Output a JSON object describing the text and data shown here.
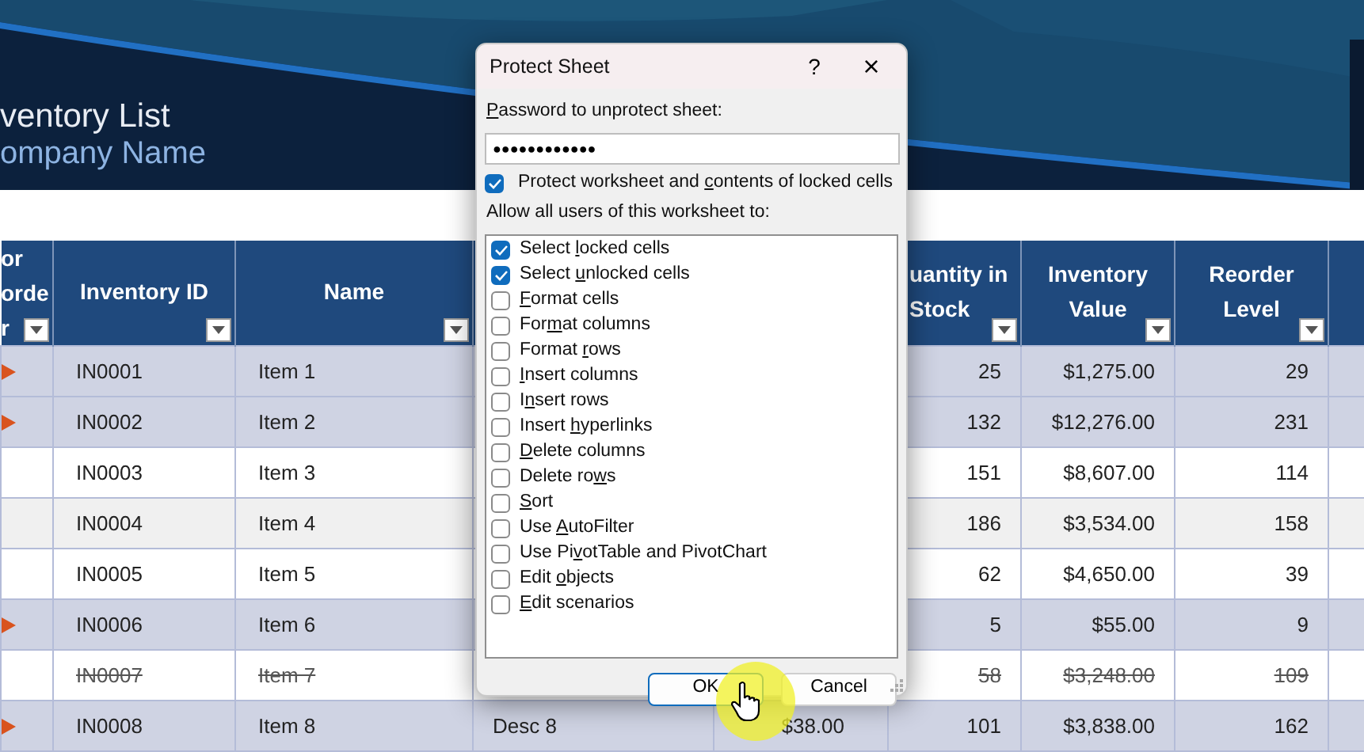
{
  "banner": {
    "title": "ventory List",
    "subtitle": "ompany Name"
  },
  "table": {
    "columns": [
      {
        "label_lines": [
          "or",
          "orde",
          "r"
        ],
        "filter": true
      },
      {
        "label": "Inventory ID",
        "filter": true
      },
      {
        "label": "Name",
        "filter": true
      },
      {},
      {},
      {
        "label": "uantity in\nStock",
        "filter": true
      },
      {
        "label": "Inventory\nValue",
        "filter": true
      },
      {
        "label": "Reorder\nLevel",
        "filter": true
      },
      {}
    ],
    "rows": [
      {
        "flagged": true,
        "shaded": false,
        "discontinued": false,
        "id": "IN0001",
        "name": "Item 1",
        "quantity": "25",
        "value": "$1,275.00",
        "reorder_level": "29"
      },
      {
        "flagged": true,
        "shaded": false,
        "discontinued": false,
        "id": "IN0002",
        "name": "Item 2",
        "quantity": "132",
        "value": "$12,276.00",
        "reorder_level": "231"
      },
      {
        "flagged": false,
        "shaded": false,
        "discontinued": false,
        "id": "IN0003",
        "name": "Item 3",
        "quantity": "151",
        "value": "$8,607.00",
        "reorder_level": "114"
      },
      {
        "flagged": false,
        "shaded": true,
        "discontinued": false,
        "id": "IN0004",
        "name": "Item 4",
        "quantity": "186",
        "value": "$3,534.00",
        "reorder_level": "158"
      },
      {
        "flagged": false,
        "shaded": false,
        "discontinued": false,
        "id": "IN0005",
        "name": "Item 5",
        "quantity": "62",
        "value": "$4,650.00",
        "reorder_level": "39"
      },
      {
        "flagged": true,
        "shaded": false,
        "discontinued": false,
        "id": "IN0006",
        "name": "Item 6",
        "quantity": "5",
        "value": "$55.00",
        "reorder_level": "9"
      },
      {
        "flagged": false,
        "shaded": false,
        "discontinued": true,
        "id": "IN0007",
        "name": "Item 7",
        "quantity": "58",
        "value": "$3,248.00",
        "reorder_level": "109"
      },
      {
        "flagged": true,
        "shaded": false,
        "discontinued": false,
        "id": "IN0008",
        "name": "Item 8",
        "description": "Desc 8",
        "unit_price": "$38.00",
        "quantity": "101",
        "value": "$3,838.00",
        "reorder_level": "162"
      }
    ]
  },
  "dialog": {
    "title": "Protect Sheet",
    "help": "?",
    "close": "×",
    "password_label": {
      "key": "P",
      "after": "assword to unprotect sheet:"
    },
    "password": "●●●●●●●●●●●●",
    "protect": {
      "label": {
        "before": "Protect worksheet and ",
        "key": "c",
        "after": "ontents of locked cells"
      },
      "checked": true
    },
    "allow_label": "Allow all users of this worksheet to:",
    "permissions": [
      {
        "label": {
          "before": "Select ",
          "key": "l",
          "after": "ocked cells"
        },
        "checked": true
      },
      {
        "label": {
          "before": "Select ",
          "key": "u",
          "after": "nlocked cells"
        },
        "checked": true
      },
      {
        "label": {
          "key": "F",
          "after": "ormat cells"
        },
        "checked": false
      },
      {
        "label": {
          "before": "For",
          "key": "m",
          "after": "at columns"
        },
        "checked": false
      },
      {
        "label": {
          "before": "Format ",
          "key": "r",
          "after": "ows"
        },
        "checked": false
      },
      {
        "label": {
          "key": "I",
          "after": "nsert columns"
        },
        "checked": false
      },
      {
        "label": {
          "before": "I",
          "key": "n",
          "after": "sert rows"
        },
        "checked": false
      },
      {
        "label": {
          "before": "Insert ",
          "key": "h",
          "after": "yperlinks"
        },
        "checked": false
      },
      {
        "label": {
          "key": "D",
          "after": "elete columns"
        },
        "checked": false
      },
      {
        "label": {
          "before": "Delete ro",
          "key": "w",
          "after": "s"
        },
        "checked": false
      },
      {
        "label": {
          "key": "S",
          "after": "ort"
        },
        "checked": false
      },
      {
        "label": {
          "before": "Use ",
          "key": "A",
          "after": "utoFilter"
        },
        "checked": false
      },
      {
        "label": {
          "before": "Use Pi",
          "key": "v",
          "after": "otTable and PivotChart"
        },
        "checked": false
      },
      {
        "label": {
          "before": "Edit ",
          "key": "o",
          "after": "bjects"
        },
        "checked": false
      },
      {
        "label": {
          "key": "E",
          "after": "dit scenarios"
        },
        "checked": false
      }
    ],
    "buttons": [
      {
        "label": "OK",
        "default": true
      },
      {
        "label": "Cancel",
        "default": false
      }
    ]
  }
}
